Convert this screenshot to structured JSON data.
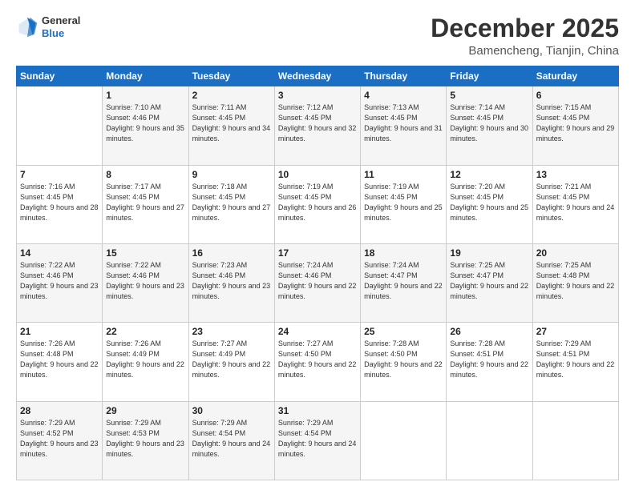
{
  "logo": {
    "line1": "General",
    "line2": "Blue"
  },
  "header": {
    "month": "December 2025",
    "location": "Bamencheng, Tianjin, China"
  },
  "weekdays": [
    "Sunday",
    "Monday",
    "Tuesday",
    "Wednesday",
    "Thursday",
    "Friday",
    "Saturday"
  ],
  "weeks": [
    [
      {
        "day": "",
        "sunrise": "",
        "sunset": "",
        "daylight": ""
      },
      {
        "day": "1",
        "sunrise": "Sunrise: 7:10 AM",
        "sunset": "Sunset: 4:46 PM",
        "daylight": "Daylight: 9 hours and 35 minutes."
      },
      {
        "day": "2",
        "sunrise": "Sunrise: 7:11 AM",
        "sunset": "Sunset: 4:45 PM",
        "daylight": "Daylight: 9 hours and 34 minutes."
      },
      {
        "day": "3",
        "sunrise": "Sunrise: 7:12 AM",
        "sunset": "Sunset: 4:45 PM",
        "daylight": "Daylight: 9 hours and 32 minutes."
      },
      {
        "day": "4",
        "sunrise": "Sunrise: 7:13 AM",
        "sunset": "Sunset: 4:45 PM",
        "daylight": "Daylight: 9 hours and 31 minutes."
      },
      {
        "day": "5",
        "sunrise": "Sunrise: 7:14 AM",
        "sunset": "Sunset: 4:45 PM",
        "daylight": "Daylight: 9 hours and 30 minutes."
      },
      {
        "day": "6",
        "sunrise": "Sunrise: 7:15 AM",
        "sunset": "Sunset: 4:45 PM",
        "daylight": "Daylight: 9 hours and 29 minutes."
      }
    ],
    [
      {
        "day": "7",
        "sunrise": "Sunrise: 7:16 AM",
        "sunset": "Sunset: 4:45 PM",
        "daylight": "Daylight: 9 hours and 28 minutes."
      },
      {
        "day": "8",
        "sunrise": "Sunrise: 7:17 AM",
        "sunset": "Sunset: 4:45 PM",
        "daylight": "Daylight: 9 hours and 27 minutes."
      },
      {
        "day": "9",
        "sunrise": "Sunrise: 7:18 AM",
        "sunset": "Sunset: 4:45 PM",
        "daylight": "Daylight: 9 hours and 27 minutes."
      },
      {
        "day": "10",
        "sunrise": "Sunrise: 7:19 AM",
        "sunset": "Sunset: 4:45 PM",
        "daylight": "Daylight: 9 hours and 26 minutes."
      },
      {
        "day": "11",
        "sunrise": "Sunrise: 7:19 AM",
        "sunset": "Sunset: 4:45 PM",
        "daylight": "Daylight: 9 hours and 25 minutes."
      },
      {
        "day": "12",
        "sunrise": "Sunrise: 7:20 AM",
        "sunset": "Sunset: 4:45 PM",
        "daylight": "Daylight: 9 hours and 25 minutes."
      },
      {
        "day": "13",
        "sunrise": "Sunrise: 7:21 AM",
        "sunset": "Sunset: 4:45 PM",
        "daylight": "Daylight: 9 hours and 24 minutes."
      }
    ],
    [
      {
        "day": "14",
        "sunrise": "Sunrise: 7:22 AM",
        "sunset": "Sunset: 4:46 PM",
        "daylight": "Daylight: 9 hours and 23 minutes."
      },
      {
        "day": "15",
        "sunrise": "Sunrise: 7:22 AM",
        "sunset": "Sunset: 4:46 PM",
        "daylight": "Daylight: 9 hours and 23 minutes."
      },
      {
        "day": "16",
        "sunrise": "Sunrise: 7:23 AM",
        "sunset": "Sunset: 4:46 PM",
        "daylight": "Daylight: 9 hours and 23 minutes."
      },
      {
        "day": "17",
        "sunrise": "Sunrise: 7:24 AM",
        "sunset": "Sunset: 4:46 PM",
        "daylight": "Daylight: 9 hours and 22 minutes."
      },
      {
        "day": "18",
        "sunrise": "Sunrise: 7:24 AM",
        "sunset": "Sunset: 4:47 PM",
        "daylight": "Daylight: 9 hours and 22 minutes."
      },
      {
        "day": "19",
        "sunrise": "Sunrise: 7:25 AM",
        "sunset": "Sunset: 4:47 PM",
        "daylight": "Daylight: 9 hours and 22 minutes."
      },
      {
        "day": "20",
        "sunrise": "Sunrise: 7:25 AM",
        "sunset": "Sunset: 4:48 PM",
        "daylight": "Daylight: 9 hours and 22 minutes."
      }
    ],
    [
      {
        "day": "21",
        "sunrise": "Sunrise: 7:26 AM",
        "sunset": "Sunset: 4:48 PM",
        "daylight": "Daylight: 9 hours and 22 minutes."
      },
      {
        "day": "22",
        "sunrise": "Sunrise: 7:26 AM",
        "sunset": "Sunset: 4:49 PM",
        "daylight": "Daylight: 9 hours and 22 minutes."
      },
      {
        "day": "23",
        "sunrise": "Sunrise: 7:27 AM",
        "sunset": "Sunset: 4:49 PM",
        "daylight": "Daylight: 9 hours and 22 minutes."
      },
      {
        "day": "24",
        "sunrise": "Sunrise: 7:27 AM",
        "sunset": "Sunset: 4:50 PM",
        "daylight": "Daylight: 9 hours and 22 minutes."
      },
      {
        "day": "25",
        "sunrise": "Sunrise: 7:28 AM",
        "sunset": "Sunset: 4:50 PM",
        "daylight": "Daylight: 9 hours and 22 minutes."
      },
      {
        "day": "26",
        "sunrise": "Sunrise: 7:28 AM",
        "sunset": "Sunset: 4:51 PM",
        "daylight": "Daylight: 9 hours and 22 minutes."
      },
      {
        "day": "27",
        "sunrise": "Sunrise: 7:29 AM",
        "sunset": "Sunset: 4:51 PM",
        "daylight": "Daylight: 9 hours and 22 minutes."
      }
    ],
    [
      {
        "day": "28",
        "sunrise": "Sunrise: 7:29 AM",
        "sunset": "Sunset: 4:52 PM",
        "daylight": "Daylight: 9 hours and 23 minutes."
      },
      {
        "day": "29",
        "sunrise": "Sunrise: 7:29 AM",
        "sunset": "Sunset: 4:53 PM",
        "daylight": "Daylight: 9 hours and 23 minutes."
      },
      {
        "day": "30",
        "sunrise": "Sunrise: 7:29 AM",
        "sunset": "Sunset: 4:54 PM",
        "daylight": "Daylight: 9 hours and 24 minutes."
      },
      {
        "day": "31",
        "sunrise": "Sunrise: 7:29 AM",
        "sunset": "Sunset: 4:54 PM",
        "daylight": "Daylight: 9 hours and 24 minutes."
      },
      {
        "day": "",
        "sunrise": "",
        "sunset": "",
        "daylight": ""
      },
      {
        "day": "",
        "sunrise": "",
        "sunset": "",
        "daylight": ""
      },
      {
        "day": "",
        "sunrise": "",
        "sunset": "",
        "daylight": ""
      }
    ]
  ]
}
